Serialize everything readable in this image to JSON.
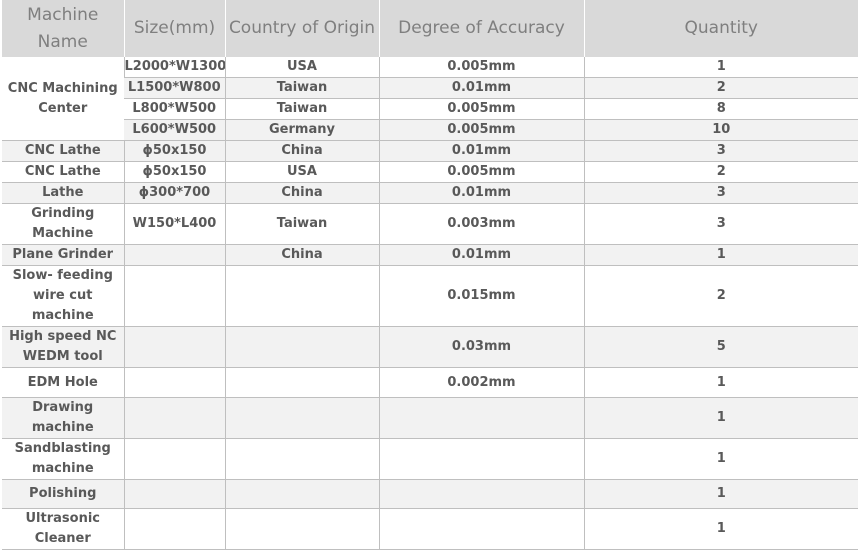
{
  "headers": {
    "name": "Machine Name",
    "size": "Size(mm)",
    "country": "Country of Origin",
    "accuracy": "Degree of Accuracy",
    "quantity": "Quantity"
  },
  "group_cnc_center": {
    "name": "CNC Machining Center",
    "rows": [
      {
        "size": "L2000*W1300",
        "country": "USA",
        "accuracy": "0.005mm",
        "quantity": "1"
      },
      {
        "size": "L1500*W800",
        "country": "Taiwan",
        "accuracy": "0.01mm",
        "quantity": "2"
      },
      {
        "size": "L800*W500",
        "country": "Taiwan",
        "accuracy": "0.005mm",
        "quantity": "8"
      },
      {
        "size": "L600*W500",
        "country": "Germany",
        "accuracy": "0.005mm",
        "quantity": "10"
      }
    ]
  },
  "rows": [
    {
      "name": "CNC Lathe",
      "size": "ϕ50x150",
      "country": "China",
      "accuracy": "0.01mm",
      "quantity": "3"
    },
    {
      "name": "CNC Lathe",
      "size": "ϕ50x150",
      "country": "USA",
      "accuracy": "0.005mm",
      "quantity": "2"
    },
    {
      "name": "Lathe",
      "size": "ϕ300*700",
      "country": "China",
      "accuracy": "0.01mm",
      "quantity": "3"
    },
    {
      "name": "Grinding Machine",
      "size": "W150*L400",
      "country": "Taiwan",
      "accuracy": "0.003mm",
      "quantity": "3"
    },
    {
      "name": "Plane Grinder",
      "size": "",
      "country": "China",
      "accuracy": "0.01mm",
      "quantity": "1"
    },
    {
      "name": "Slow- feeding wire cut machine",
      "size": "",
      "country": "",
      "accuracy": "0.015mm",
      "quantity": "2"
    },
    {
      "name": "High speed NC WEDM tool",
      "size": "",
      "country": "",
      "accuracy": "0.03mm",
      "quantity": "5"
    },
    {
      "name": "EDM Hole",
      "size": "",
      "country": "",
      "accuracy": "0.002mm",
      "quantity": "1"
    },
    {
      "name": "Drawing machine",
      "size": "",
      "country": "",
      "accuracy": "",
      "quantity": "1"
    },
    {
      "name": "Sandblasting machine",
      "size": "",
      "country": "",
      "accuracy": "",
      "quantity": "1"
    },
    {
      "name": "Polishing",
      "size": "",
      "country": "",
      "accuracy": "",
      "quantity": "1"
    },
    {
      "name": "Ultrasonic Cleaner",
      "size": "",
      "country": "",
      "accuracy": "",
      "quantity": "1"
    }
  ]
}
